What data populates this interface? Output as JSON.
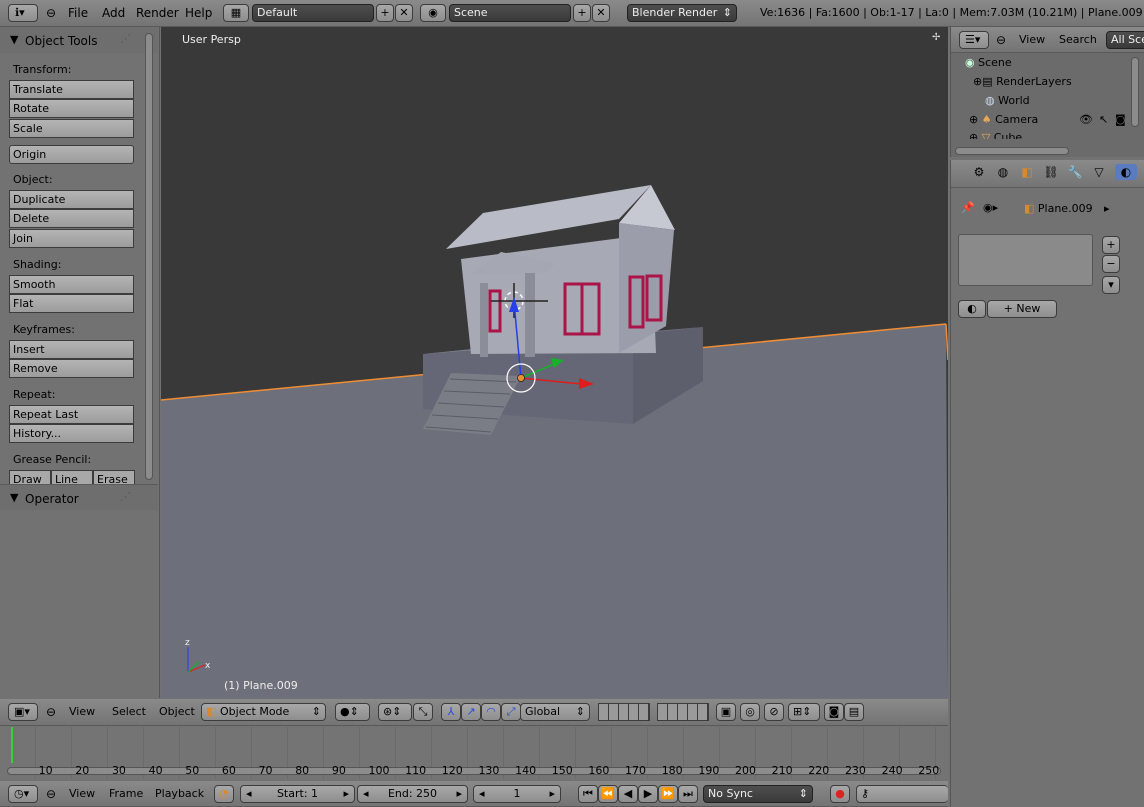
{
  "top_bar": {
    "menus": [
      "File",
      "Add",
      "Render",
      "Help"
    ],
    "layout": "Default",
    "scene": "Scene",
    "engine": "Blender Render",
    "stats": "Ve:1636 | Fa:1600 | Ob:1-17 | La:0 | Mem:7.03M (10.21M) | Plane.009"
  },
  "tool_panel": {
    "title": "Object Tools",
    "sections": [
      {
        "label": "Transform:",
        "buttons": [
          "Translate",
          "Rotate",
          "Scale"
        ]
      },
      {
        "label": "",
        "buttons": [
          "Origin"
        ]
      },
      {
        "label": "Object:",
        "buttons": [
          "Duplicate",
          "Delete",
          "Join"
        ]
      },
      {
        "label": "Shading:",
        "buttons": [
          "Smooth",
          "Flat"
        ]
      },
      {
        "label": "Keyframes:",
        "buttons": [
          "Insert",
          "Remove"
        ]
      },
      {
        "label": "Repeat:",
        "buttons": [
          "Repeat Last",
          "History..."
        ]
      },
      {
        "label": "Grease Pencil:",
        "buttons": [
          "Draw",
          "Line",
          "Erase"
        ]
      }
    ],
    "operator_title": "Operator"
  },
  "viewport": {
    "label": "User Persp",
    "object_label": "(1) Plane.009"
  },
  "viewport_header": {
    "menus": [
      "View",
      "Select",
      "Object"
    ],
    "mode": "Object Mode",
    "orientation": "Global"
  },
  "outliner": {
    "menus": [
      "View",
      "Search"
    ],
    "filter": "All Sce",
    "items": [
      "Scene",
      "RenderLayers",
      "World",
      "Camera",
      "Cube"
    ]
  },
  "properties": {
    "object_name": "Plane.009",
    "new_label": "New"
  },
  "timeline": {
    "ticks": [
      10,
      20,
      30,
      40,
      50,
      60,
      70,
      80,
      90,
      100,
      110,
      120,
      130,
      140,
      150,
      160,
      170,
      180,
      190,
      200,
      210,
      220,
      230,
      240,
      250
    ],
    "current_frame": 0
  },
  "timeline_header": {
    "menus": [
      "View",
      "Frame",
      "Playback"
    ],
    "start": "Start: 1",
    "end": "End: 250",
    "frame": "1",
    "sync": "No Sync"
  }
}
